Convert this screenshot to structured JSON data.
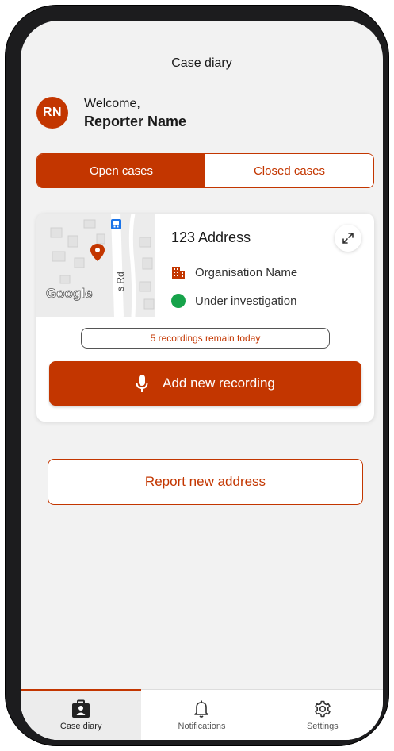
{
  "header": {
    "title": "Case diary"
  },
  "user": {
    "initials": "RN",
    "greeting": "Welcome,",
    "name": "Reporter Name"
  },
  "segments": [
    {
      "label": "Open cases",
      "active": true
    },
    {
      "label": "Closed cases",
      "active": false
    }
  ],
  "case_card": {
    "map": {
      "provider_logo": "Google",
      "street_label": "s Rd"
    },
    "address": "123 Address",
    "organisation": "Organisation Name",
    "status": "Under investigation",
    "recordings_remaining": "5 recordings remain today",
    "add_recording_label": "Add new recording"
  },
  "report_button_label": "Report new address",
  "tabs": [
    {
      "label": "Case diary",
      "icon": "briefcase-icon",
      "active": true
    },
    {
      "label": "Notifications",
      "icon": "bell-icon",
      "active": false
    },
    {
      "label": "Settings",
      "icon": "gear-icon",
      "active": false
    }
  ],
  "colors": {
    "accent": "#c33600",
    "status_green": "#16a34a",
    "background": "#f2f2f2"
  }
}
